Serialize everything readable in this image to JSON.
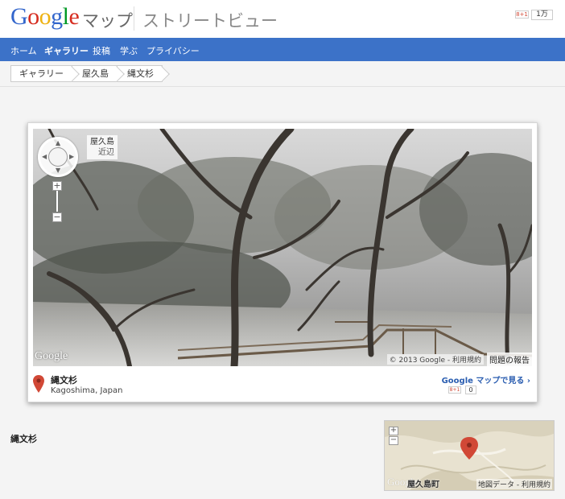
{
  "header": {
    "logo_letters": [
      {
        "ch": "G",
        "color": "#3366cc"
      },
      {
        "ch": "o",
        "color": "#d62d20"
      },
      {
        "ch": "o",
        "color": "#eeb211"
      },
      {
        "ch": "g",
        "color": "#3366cc"
      },
      {
        "ch": "l",
        "color": "#009925"
      },
      {
        "ch": "e",
        "color": "#d62d20"
      }
    ],
    "product": "マップ",
    "section": "ストリートビュー",
    "gplus_label": "8+1",
    "gplus_count": "1万"
  },
  "nav": {
    "items": [
      "ホーム",
      "ギャラリー",
      "投稿",
      "学ぶ",
      "プライバシー"
    ],
    "active": "ギャラリー"
  },
  "breadcrumb": [
    "ギャラリー",
    "屋久島",
    "縄文杉"
  ],
  "viewer": {
    "location_title": "屋久島",
    "location_sub": "近辺",
    "logo": "Google",
    "copyright": "© 2013 Google - 利用規約",
    "report": "問題の報告"
  },
  "place": {
    "name": "縄文杉",
    "address": "Kagoshima, Japan",
    "maps_link": "Google マップで見る ›",
    "gplus_label": "8+1",
    "gplus_count": "0"
  },
  "page_title": "縄文杉",
  "minimap": {
    "town": "屋久島町",
    "logo": "Google",
    "copyright": "地図データ - 利用規約"
  },
  "colors": {
    "nav_bg": "#3c72c8",
    "link": "#2a5db0",
    "marker": "#d14836"
  }
}
